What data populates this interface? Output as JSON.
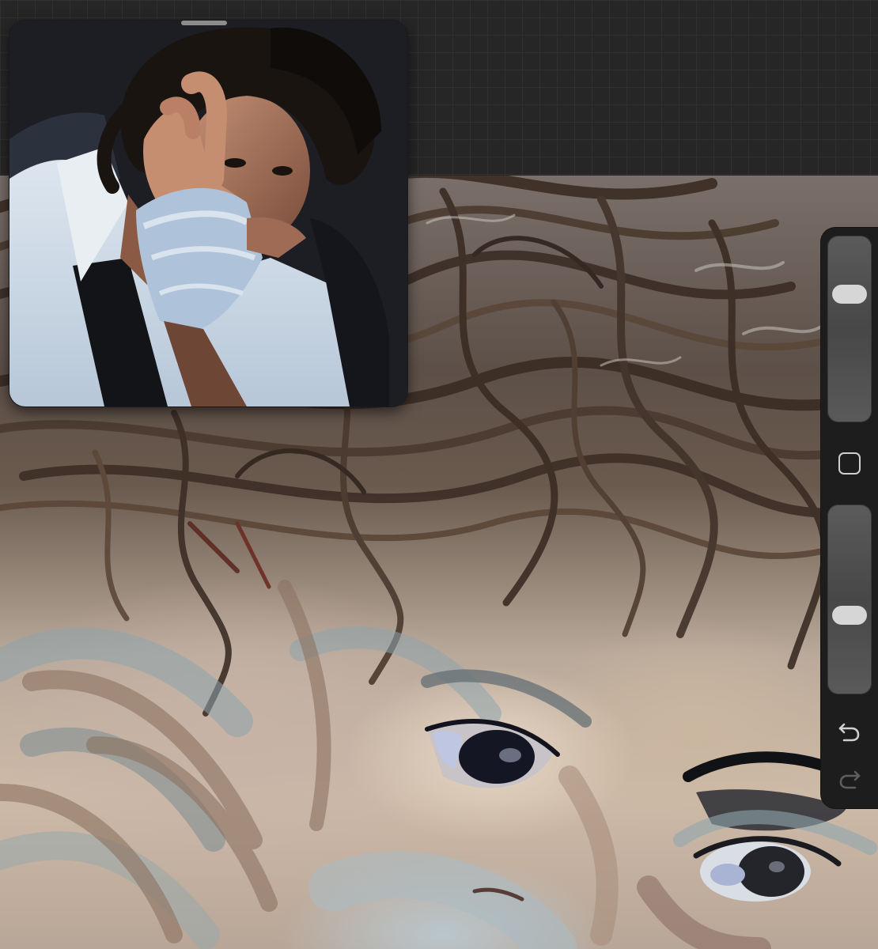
{
  "app": {
    "accent": "#d6d6d6",
    "background": "#262626"
  },
  "reference_window": {
    "icon": "drag-handle-icon"
  },
  "sidebar": {
    "brush_size_level": 0.72,
    "opacity_level": 0.4,
    "modify_icon": "square-icon",
    "undo_icon": "undo-icon",
    "redo_icon": "redo-icon"
  }
}
